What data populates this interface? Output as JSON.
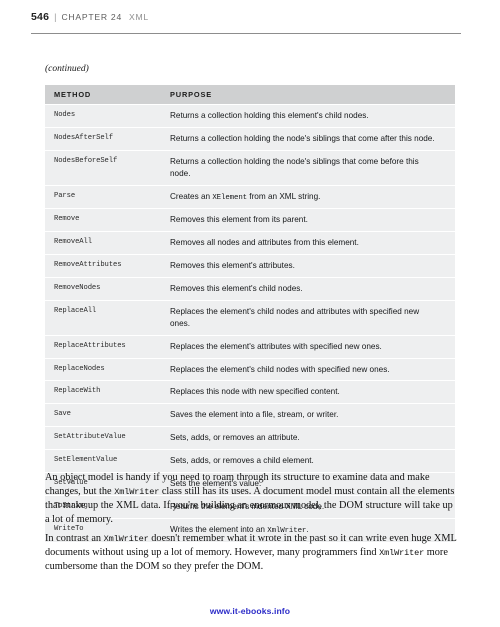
{
  "header": {
    "folio": "546",
    "separator": "|",
    "chapter_label": "CHAPTER 24",
    "chapter_topic": "XML"
  },
  "table": {
    "continued_note": "(continued)",
    "columns": [
      "METHOD",
      "PURPOSE"
    ],
    "rows": [
      {
        "method": "Nodes",
        "purpose_pre": "Returns a collection holding this element's child nodes.",
        "purpose_code": "",
        "purpose_post": ""
      },
      {
        "method": "NodesAfterSelf",
        "purpose_pre": "Returns a collection holding the node's siblings that come after this node.",
        "purpose_code": "",
        "purpose_post": ""
      },
      {
        "method": "NodesBeforeSelf",
        "purpose_pre": "Returns a collection holding the node's siblings that come before this node.",
        "purpose_code": "",
        "purpose_post": ""
      },
      {
        "method": "Parse",
        "purpose_pre": "Creates an ",
        "purpose_code": "XElement",
        "purpose_post": " from an XML string."
      },
      {
        "method": "Remove",
        "purpose_pre": "Removes this element from its parent.",
        "purpose_code": "",
        "purpose_post": ""
      },
      {
        "method": "RemoveAll",
        "purpose_pre": "Removes all nodes and attributes from this element.",
        "purpose_code": "",
        "purpose_post": ""
      },
      {
        "method": "RemoveAttributes",
        "purpose_pre": "Removes this element's attributes.",
        "purpose_code": "",
        "purpose_post": ""
      },
      {
        "method": "RemoveNodes",
        "purpose_pre": "Removes this element's child nodes.",
        "purpose_code": "",
        "purpose_post": ""
      },
      {
        "method": "ReplaceAll",
        "purpose_pre": "Replaces the element's child nodes and attributes with specified new ones.",
        "purpose_code": "",
        "purpose_post": ""
      },
      {
        "method": "ReplaceAttributes",
        "purpose_pre": "Replaces the element's attributes with specified new ones.",
        "purpose_code": "",
        "purpose_post": ""
      },
      {
        "method": "ReplaceNodes",
        "purpose_pre": "Replaces the element's child nodes with specified new ones.",
        "purpose_code": "",
        "purpose_post": ""
      },
      {
        "method": "ReplaceWith",
        "purpose_pre": "Replaces this node with new specified content.",
        "purpose_code": "",
        "purpose_post": ""
      },
      {
        "method": "Save",
        "purpose_pre": "Saves the element into a file, stream, or writer.",
        "purpose_code": "",
        "purpose_post": ""
      },
      {
        "method": "SetAttributeValue",
        "purpose_pre": "Sets, adds, or removes an attribute.",
        "purpose_code": "",
        "purpose_post": ""
      },
      {
        "method": "SetElementValue",
        "purpose_pre": "Sets, adds, or removes a child element.",
        "purpose_code": "",
        "purpose_post": ""
      },
      {
        "method": "SetValue",
        "purpose_pre": "Sets the element's value.",
        "purpose_code": "",
        "purpose_post": ""
      },
      {
        "method": "ToString",
        "purpose_pre": "Returns the element's indented XML code.",
        "purpose_code": "",
        "purpose_post": ""
      },
      {
        "method": "WriteTo",
        "purpose_pre": "Writes the element into an ",
        "purpose_code": "XmlWriter",
        "purpose_post": "."
      }
    ]
  },
  "paragraphs": {
    "p1_a": "An object model is handy if you need to roam through its structure to examine data and make changes, but the ",
    "p1_code1": "XmlWriter",
    "p1_b": " class still has its uses. A document model must contain all the elements that make up the XML data. If you're building an enormous model, the DOM structure will take up a lot of memory.",
    "p2_a": "In contrast an ",
    "p2_code1": "XmlWriter",
    "p2_b": " doesn't remember what it wrote in the past so it can write even huge XML documents without using up a lot of memory. However, many programmers find ",
    "p2_code2": "XmlWriter",
    "p2_c": " more cumbersome than the DOM so they prefer the DOM."
  },
  "footer": {
    "link_text": "www.it-ebooks.info"
  },
  "colors": {
    "table_header_bg": "#cfd0d1",
    "table_row_bg": "#eeeff0",
    "header_rule": "#8d8d8d",
    "link": "#2c2cc8"
  }
}
